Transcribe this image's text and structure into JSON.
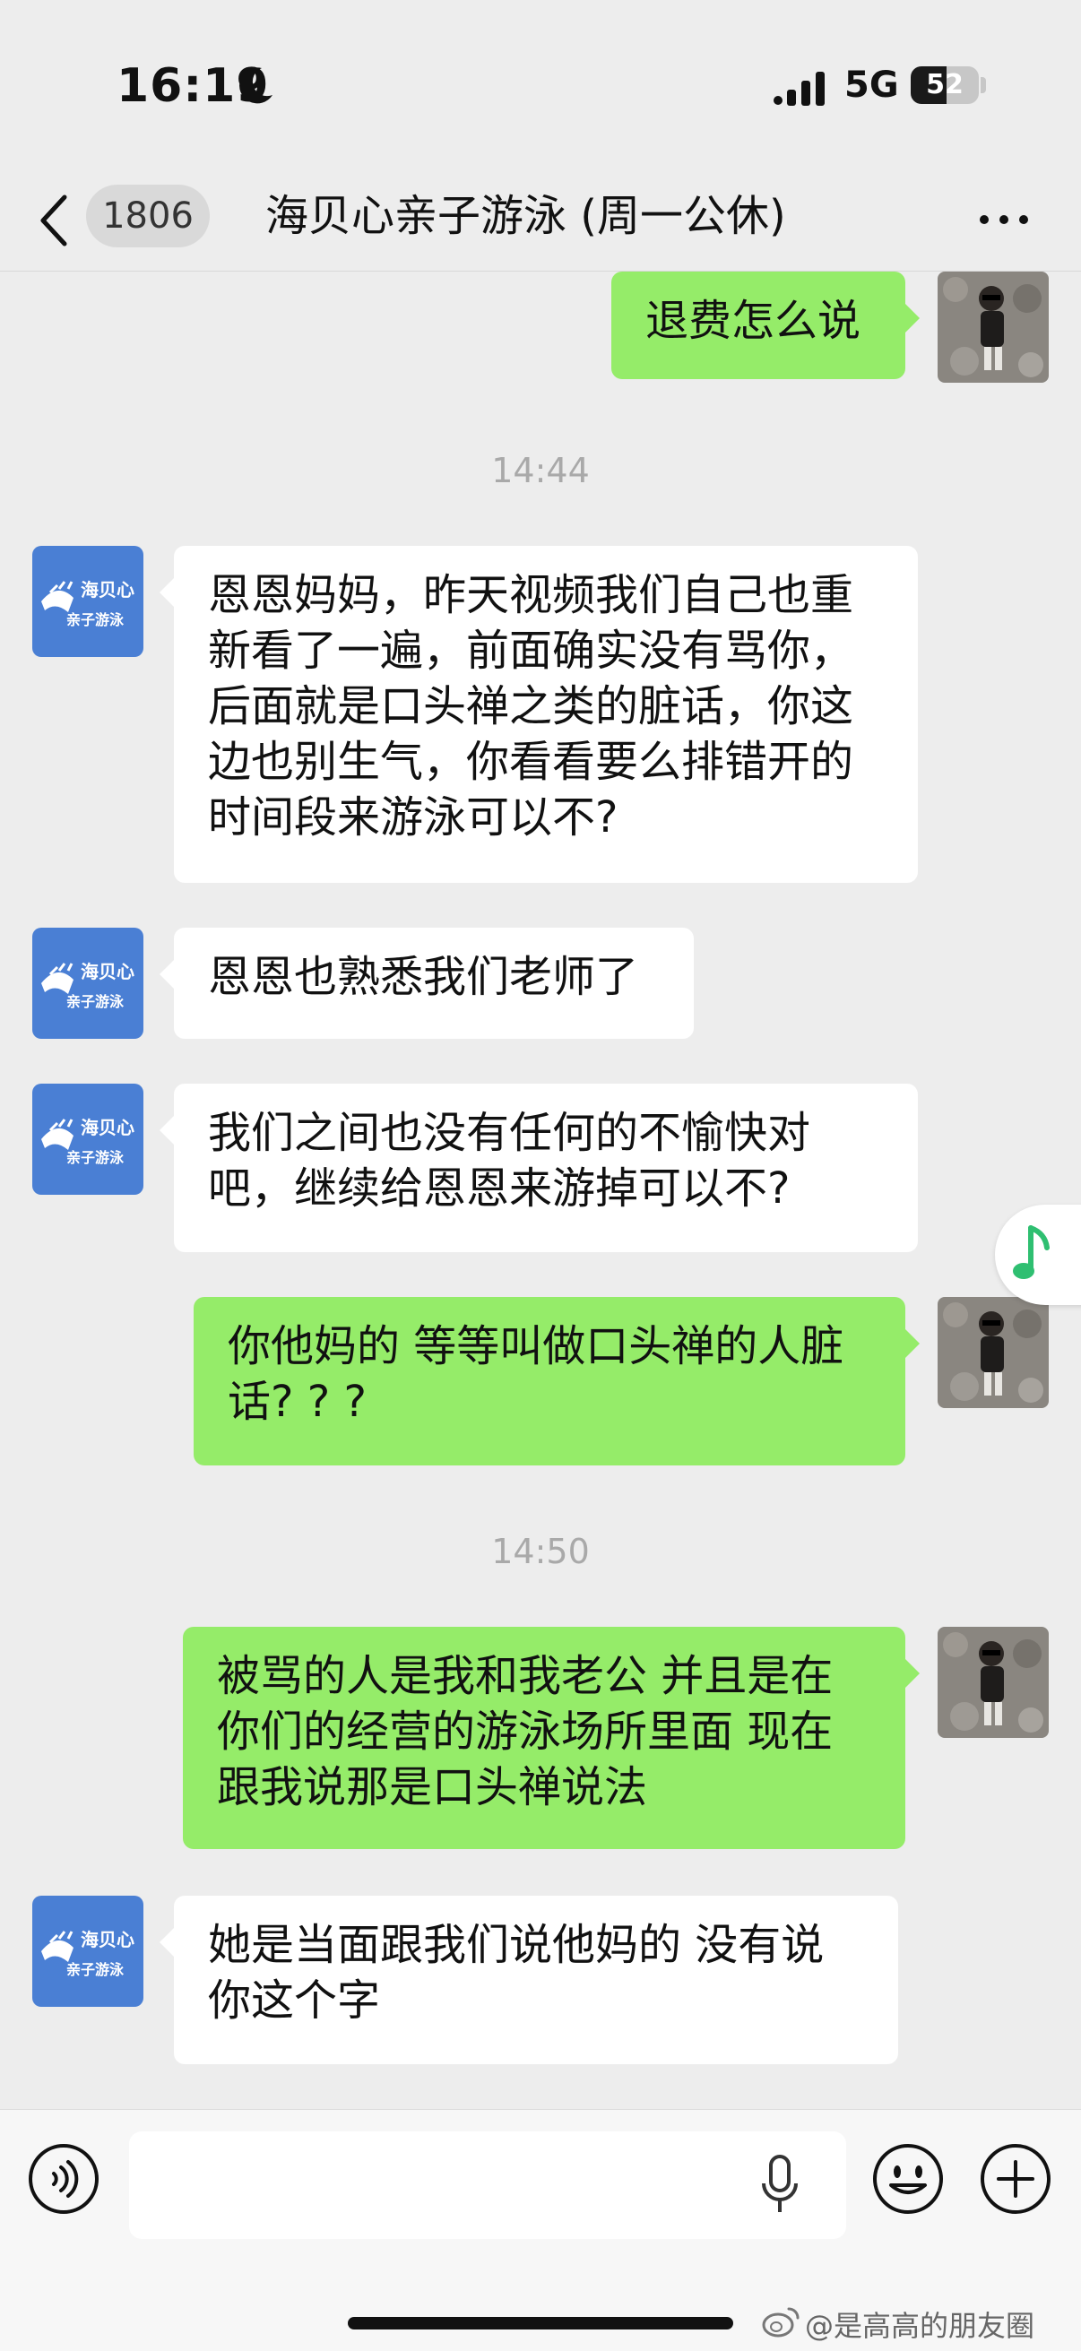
{
  "status_bar": {
    "time": "16:19",
    "network": "5G",
    "battery_level": "52",
    "battery_fraction": 0.52,
    "icons": [
      "moon-icon",
      "signal-icon",
      "battery-icon"
    ]
  },
  "nav": {
    "unread_count": "1806",
    "title": "海贝心亲子游泳 (周一公休)",
    "icons": [
      "back-icon",
      "more-icon"
    ]
  },
  "colors": {
    "background": "#ededed",
    "outgoing_bubble": "#95ec69",
    "incoming_bubble": "#ffffff",
    "shop_avatar": "#4a7fd4"
  },
  "shop_avatar": {
    "name": "海贝心",
    "subtitle": "亲子游泳"
  },
  "messages": [
    {
      "type": "out",
      "text": "退费怎么说"
    },
    {
      "type": "time",
      "text": "14:44"
    },
    {
      "type": "in",
      "text": "恩恩妈妈，昨天视频我们自己也重新看了一遍，前面确实没有骂你，后面就是口头禅之类的脏话，你这边也别生气，你看看要么排错开的时间段来游泳可以不?"
    },
    {
      "type": "in",
      "text": "恩恩也熟悉我们老师了"
    },
    {
      "type": "in",
      "text": "我们之间也没有任何的不愉快对吧，继续给恩恩来游掉可以不?"
    },
    {
      "type": "out",
      "text": "你他妈的 等等叫做口头禅的人脏话? ? ?"
    },
    {
      "type": "time",
      "text": "14:50"
    },
    {
      "type": "out",
      "text": "被骂的人是我和我老公  并且是在你们的经营的游泳场所里面 现在跟我说那是口头禅说法"
    },
    {
      "type": "in",
      "text": "她是当面跟我们说他妈的  没有说你这个字"
    }
  ],
  "input_bar": {
    "placeholder": "",
    "icons": [
      "voice-icon",
      "microphone-icon",
      "emoji-icon",
      "plus-icon"
    ]
  },
  "watermark": "@是高高的朋友圈"
}
